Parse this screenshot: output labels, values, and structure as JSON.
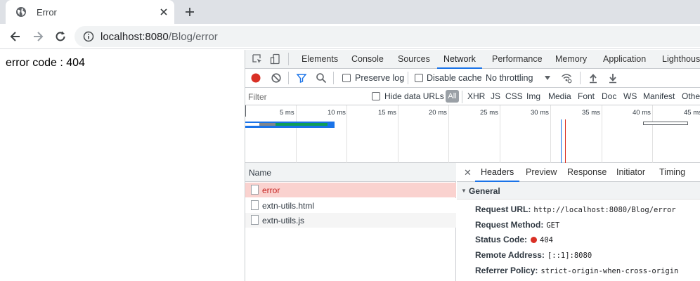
{
  "browser": {
    "tab": {
      "title": "Error",
      "icon": "globe-icon"
    },
    "new_tab_icon": "plus-icon",
    "omnibox": {
      "host": "localhost:8080",
      "path": "/Blog/error"
    }
  },
  "page": {
    "message": "error code : 404"
  },
  "devtools": {
    "tabs": [
      "Elements",
      "Console",
      "Sources",
      "Network",
      "Performance",
      "Memory",
      "Application",
      "Lighthouse"
    ],
    "active_tab": "Network",
    "network_toolbar": {
      "preserve_log": "Preserve log",
      "disable_cache": "Disable cache",
      "throttling": "No throttling"
    },
    "filter": {
      "placeholder": "Filter",
      "hide_data_urls": "Hide data URLs",
      "all": "All",
      "types": [
        "XHR",
        "JS",
        "CSS",
        "Img",
        "Media",
        "Font",
        "Doc",
        "WS",
        "Manifest",
        "Other"
      ]
    },
    "timeline": {
      "ticks": [
        "5 ms",
        "10 ms",
        "15 ms",
        "20 ms",
        "25 ms",
        "30 ms",
        "35 ms",
        "40 ms",
        "45 ms"
      ]
    },
    "requests": {
      "header": "Name",
      "rows": [
        {
          "name": "error",
          "status": "error"
        },
        {
          "name": "extn-utils.html",
          "status": "ok"
        },
        {
          "name": "extn-utils.js",
          "status": "ok"
        }
      ]
    },
    "details": {
      "tabs": [
        "Headers",
        "Preview",
        "Response",
        "Initiator",
        "Timing"
      ],
      "active_tab": "Headers",
      "section_title": "General",
      "general": [
        {
          "key": "Request URL:",
          "value": "http://localhost:8080/Blog/error"
        },
        {
          "key": "Request Method:",
          "value": "GET"
        },
        {
          "key": "Status Code:",
          "value": "404"
        },
        {
          "key": "Remote Address:",
          "value": "[::1]:8080"
        },
        {
          "key": "Referrer Policy:",
          "value": "strict-origin-when-cross-origin"
        }
      ]
    }
  },
  "colors": {
    "accent": "#1a73e8",
    "error_row": "#fad2cf",
    "error_text": "#c5221f",
    "record": "#d93025"
  }
}
